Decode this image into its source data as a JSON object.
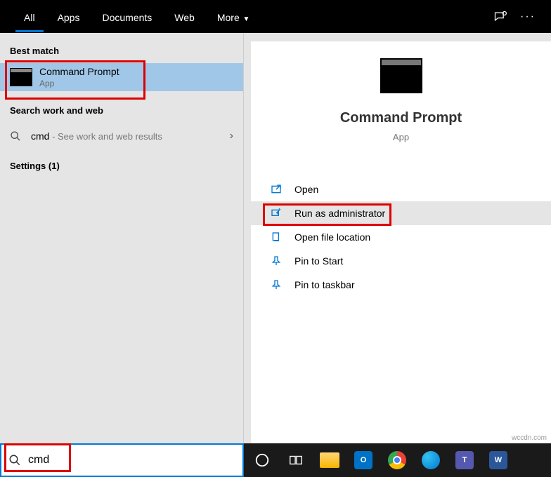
{
  "header": {
    "tabs": [
      "All",
      "Apps",
      "Documents",
      "Web",
      "More"
    ],
    "active_tab": 0
  },
  "left": {
    "best_match_label": "Best match",
    "result_title": "Command Prompt",
    "result_sub": "App",
    "search_section_label": "Search work and web",
    "search_prefix": "cmd",
    "search_suffix": " - See work and web results",
    "settings_label": "Settings (1)"
  },
  "right": {
    "title": "Command Prompt",
    "sub": "App",
    "actions": [
      {
        "label": "Open"
      },
      {
        "label": "Run as administrator"
      },
      {
        "label": "Open file location"
      },
      {
        "label": "Pin to Start"
      },
      {
        "label": "Pin to taskbar"
      }
    ]
  },
  "search": {
    "value": "cmd"
  },
  "watermark": "wccdn.com"
}
